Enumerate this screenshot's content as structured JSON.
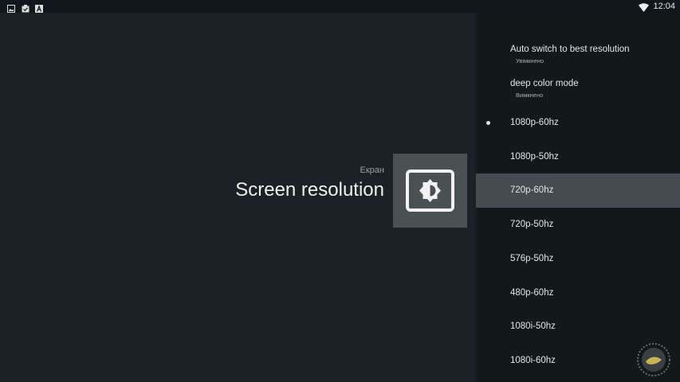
{
  "status_bar": {
    "icons": [
      "image-icon",
      "clipboard-check-icon",
      "a-icon",
      "wifi-icon"
    ],
    "time": "12:04"
  },
  "main": {
    "category": "Екран",
    "title": "Screen resolution",
    "tile_icon": "brightness-icon"
  },
  "settings": {
    "auto_switch": {
      "label": "Auto switch to best resolution",
      "value": "Увімкнено"
    },
    "deep_color": {
      "label": "deep color mode",
      "value": "Вимкнено"
    },
    "resolutions": [
      {
        "label": "1080p-60hz",
        "current": true
      },
      {
        "label": "1080p-50hz",
        "current": false
      },
      {
        "label": "720p-60hz",
        "current": false,
        "focused": true
      },
      {
        "label": "720p-50hz",
        "current": false
      },
      {
        "label": "576p-50hz",
        "current": false
      },
      {
        "label": "480p-60hz",
        "current": false
      },
      {
        "label": "1080i-50hz",
        "current": false
      },
      {
        "label": "1080i-60hz",
        "current": false
      }
    ]
  },
  "colors": {
    "background": "#1b2124",
    "panel": "#13181b",
    "focused_row": "#454c4f",
    "tile": "#4a5153"
  }
}
